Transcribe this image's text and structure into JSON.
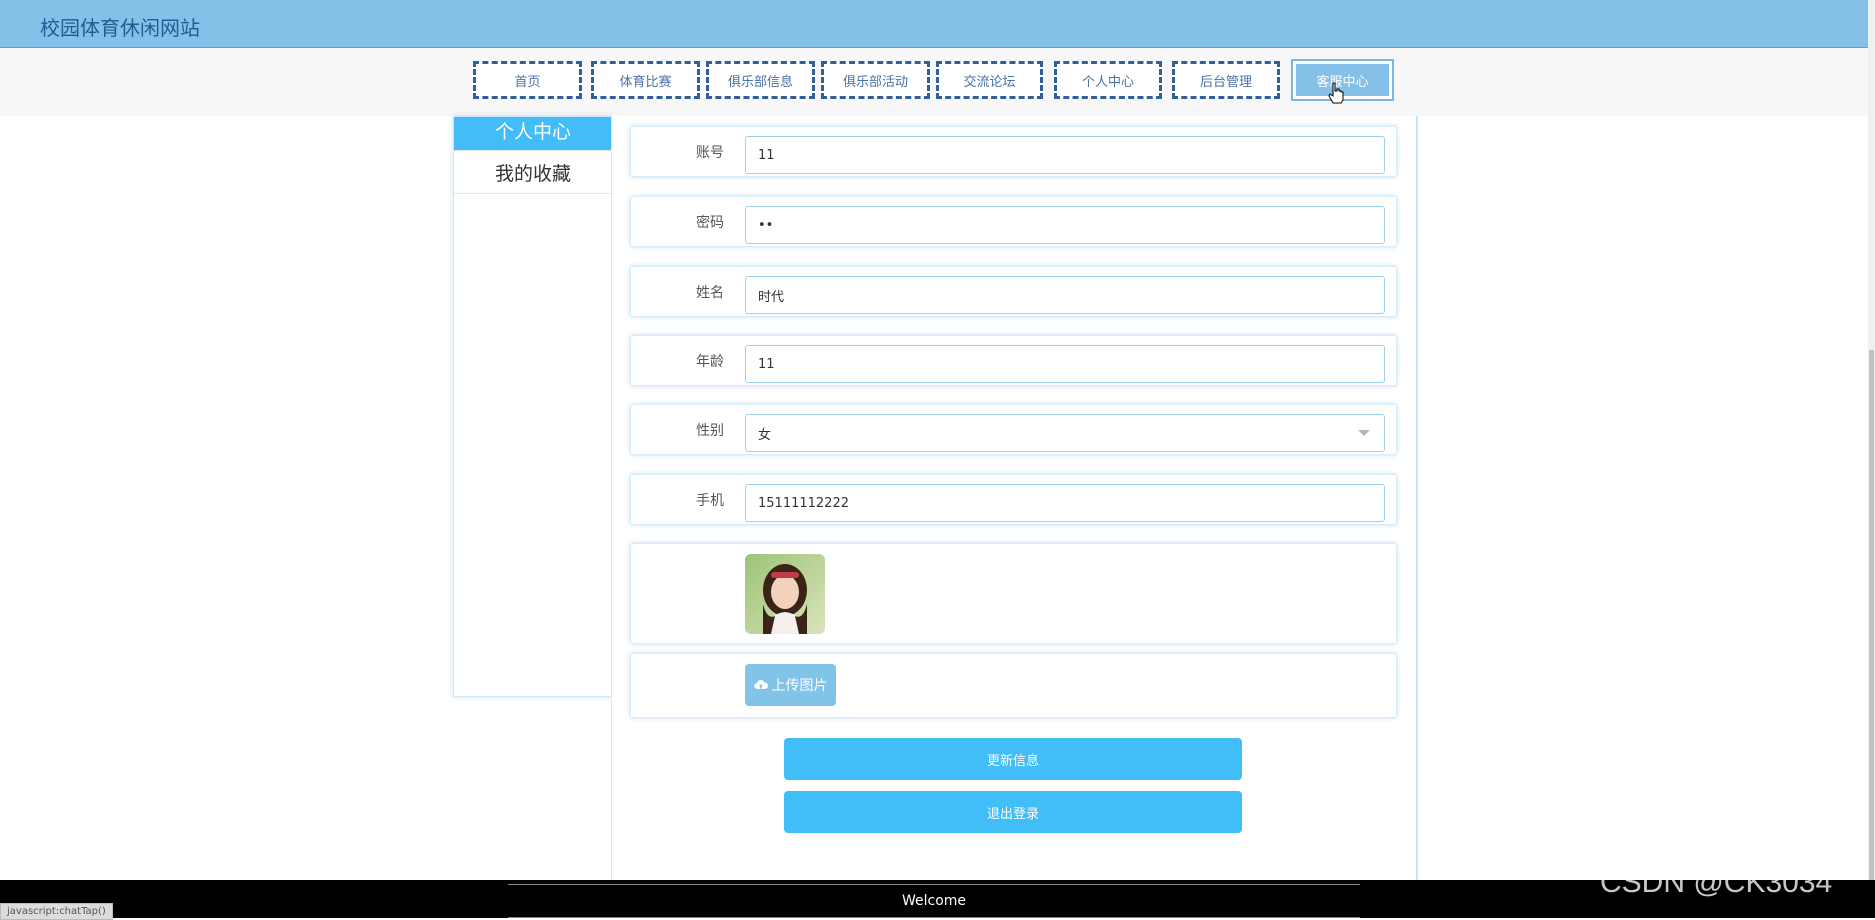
{
  "site": {
    "title": "校园体育休闲网站"
  },
  "nav": {
    "items": [
      {
        "label": "首页"
      },
      {
        "label": "体育比赛"
      },
      {
        "label": "俱乐部信息"
      },
      {
        "label": "俱乐部活动"
      },
      {
        "label": "交流论坛"
      },
      {
        "label": "个人中心"
      },
      {
        "label": "后台管理"
      },
      {
        "label": "客服中心",
        "active": true
      }
    ]
  },
  "sidebar": {
    "items": [
      {
        "label": "个人中心",
        "active": true
      },
      {
        "label": "我的收藏"
      }
    ]
  },
  "form": {
    "account_label": "账号",
    "account_value": "11",
    "password_label": "密码",
    "password_value": "••",
    "name_label": "姓名",
    "name_value": "时代",
    "age_label": "年龄",
    "age_value": "11",
    "gender_label": "性别",
    "gender_value": "女",
    "phone_label": "手机",
    "phone_value": "15111112222",
    "upload_label": "上传图片"
  },
  "actions": {
    "update_label": "更新信息",
    "logout_label": "退出登录"
  },
  "footer": {
    "text": "Welcome"
  },
  "status_bar": {
    "url": "javascript:chatTap()"
  },
  "watermark": {
    "text": "CSDN @CK3034"
  },
  "colors": {
    "header": "#84c0e8",
    "accent": "#41bdf7",
    "nav_border": "#30609a"
  }
}
